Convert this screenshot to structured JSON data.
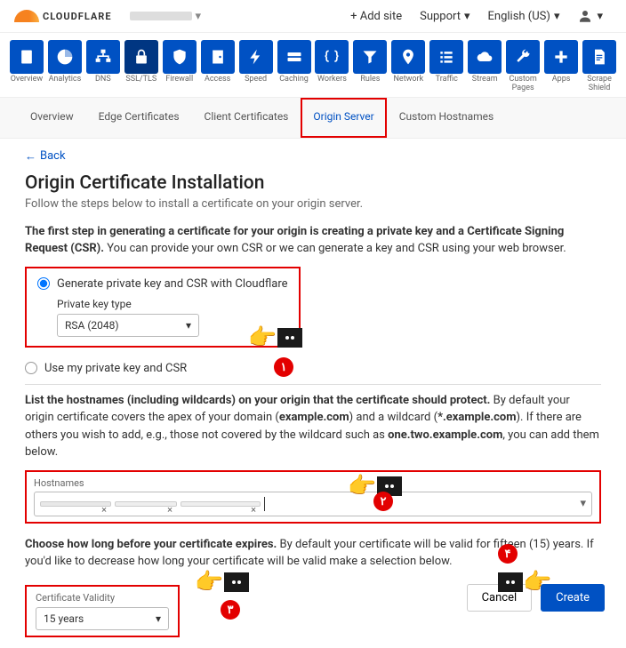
{
  "header": {
    "brand": "CLOUDFLARE",
    "addSite": "+ Add site",
    "support": "Support",
    "lang": "English (US)"
  },
  "nav": [
    {
      "label": "Overview",
      "icon": "file"
    },
    {
      "label": "Analytics",
      "icon": "pie"
    },
    {
      "label": "DNS",
      "icon": "tree"
    },
    {
      "label": "SSL/TLS",
      "icon": "lock",
      "active": true
    },
    {
      "label": "Firewall",
      "icon": "shield"
    },
    {
      "label": "Access",
      "icon": "door"
    },
    {
      "label": "Speed",
      "icon": "bolt"
    },
    {
      "label": "Caching",
      "icon": "drive"
    },
    {
      "label": "Workers",
      "icon": "braces"
    },
    {
      "label": "Rules",
      "icon": "funnel"
    },
    {
      "label": "Network",
      "icon": "pin"
    },
    {
      "label": "Traffic",
      "icon": "list"
    },
    {
      "label": "Stream",
      "icon": "cloud"
    },
    {
      "label": "Custom Pages",
      "icon": "wrench"
    },
    {
      "label": "Apps",
      "icon": "plus"
    },
    {
      "label": "Scrape Shield",
      "icon": "doc"
    }
  ],
  "tabs": [
    "Overview",
    "Edge Certificates",
    "Client Certificates",
    "Origin Server",
    "Custom Hostnames"
  ],
  "activeTab": "Origin Server",
  "back": "Back",
  "title": "Origin Certificate Installation",
  "subtitle": "Follow the steps below to install a certificate on your origin server.",
  "step1": {
    "bold": "The first step in generating a certificate for your origin is creating a private key and a Certificate Signing Request (CSR).",
    "rest": " You can provide your own CSR or we can generate a key and CSR using your web browser."
  },
  "opt1": "Generate private key and CSR with Cloudflare",
  "pkLabel": "Private key type",
  "pkValue": "RSA (2048)",
  "opt2": "Use my private key and CSR",
  "step2": {
    "b1": "List the hostnames (including wildcards) on your origin that the certificate should protect.",
    "t1": " By default your origin certificate covers the apex of your domain (",
    "b2": "example.com",
    "t2": ") and a wildcard (",
    "b3": "*.example.com",
    "t3": "). If there are others you wish to add, e.g., those not covered by the wildcard such as ",
    "b4": "one.two.example.com",
    "t4": ", you can add them below."
  },
  "hostLabel": "Hostnames",
  "step3": {
    "b": "Choose how long before your certificate expires.",
    "t": " By default your certificate will be valid for fifteen (15) years. If you'd like to decrease how long your certificate will be valid make a selection below."
  },
  "validLabel": "Certificate Validity",
  "validValue": "15 years",
  "cancel": "Cancel",
  "create": "Create",
  "badges": [
    "۱",
    "۲",
    "۳",
    "۴"
  ]
}
